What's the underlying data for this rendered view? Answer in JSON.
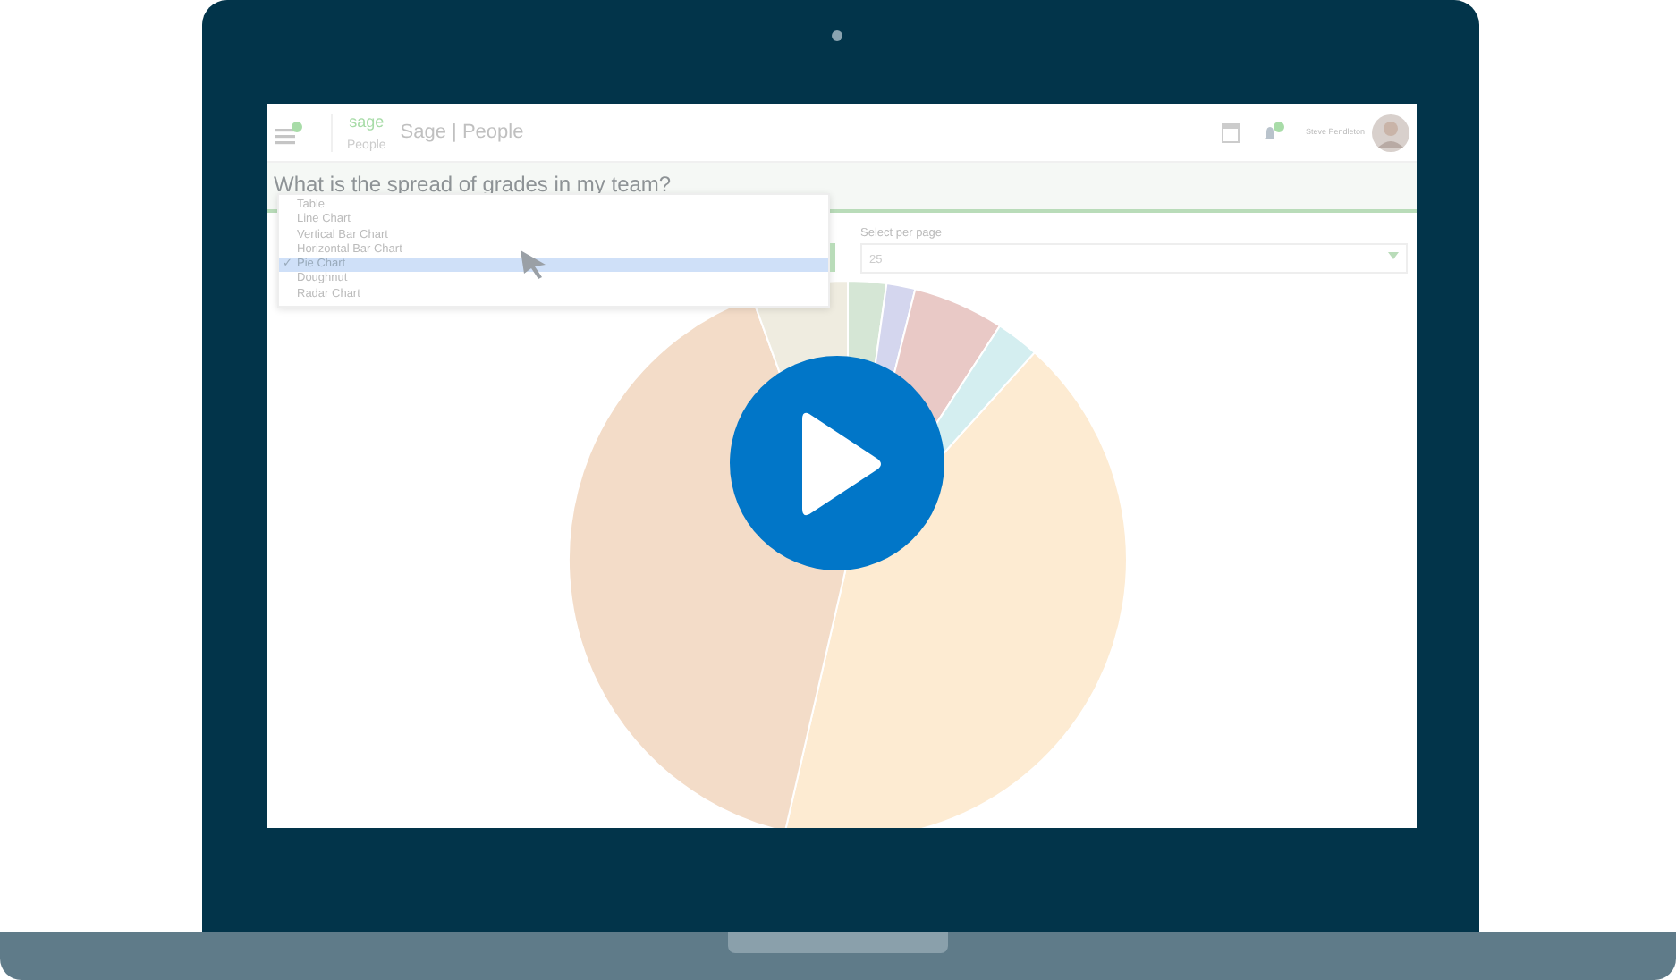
{
  "header": {
    "logo": "sage",
    "logo_sub": "People",
    "title": "Sage | People",
    "user": "Steve Pendleton"
  },
  "question": "What is the spread of grades in my team?",
  "chart_menu": [
    {
      "label": "Table",
      "selected": false
    },
    {
      "label": "Line Chart",
      "selected": false
    },
    {
      "label": "Vertical Bar Chart",
      "selected": false
    },
    {
      "label": "Horizontal Bar Chart",
      "selected": false
    },
    {
      "label": "Pie Chart",
      "selected": true
    },
    {
      "label": "Doughnut",
      "selected": false
    },
    {
      "label": "Radar Chart",
      "selected": false
    }
  ],
  "per_page": {
    "label": "Select per page",
    "value": "25"
  },
  "check_mark": "✓"
}
